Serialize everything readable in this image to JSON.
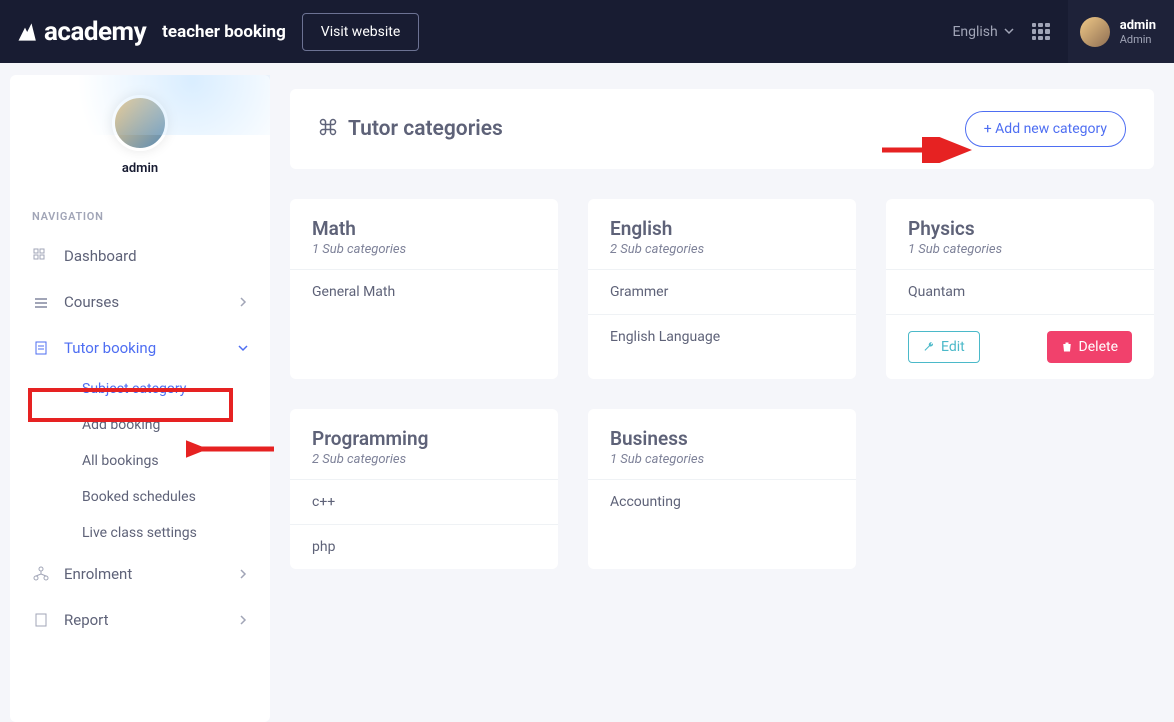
{
  "topnav": {
    "logo_text": "academy",
    "product_name": "teacher booking",
    "visit_label": "Visit website",
    "language": "English",
    "user_name": "admin",
    "user_role": "Admin"
  },
  "sidebar": {
    "profile_name": "admin",
    "section_label": "NAVIGATION",
    "items": {
      "dashboard": "Dashboard",
      "courses": "Courses",
      "tutor_booking": "Tutor booking",
      "enrolment": "Enrolment",
      "report": "Report"
    },
    "tutor_booking_children": {
      "subject_category": "Subject category",
      "add_booking": "Add booking",
      "all_bookings": "All bookings",
      "booked_schedules": "Booked schedules",
      "live_class_settings": "Live class settings"
    }
  },
  "page": {
    "title": "Tutor categories",
    "add_btn": "+ Add new category"
  },
  "action_labels": {
    "edit": "Edit",
    "delete": "Delete"
  },
  "categories": [
    {
      "title": "Math",
      "sub_label": "1 Sub categories",
      "subs": [
        "General Math"
      ],
      "show_actions": false
    },
    {
      "title": "English",
      "sub_label": "2 Sub categories",
      "subs": [
        "Grammer",
        "English Language"
      ],
      "show_actions": false
    },
    {
      "title": "Physics",
      "sub_label": "1 Sub categories",
      "subs": [
        "Quantam"
      ],
      "show_actions": true
    },
    {
      "title": "Programming",
      "sub_label": "2 Sub categories",
      "subs": [
        "c++",
        "php"
      ],
      "show_actions": false
    },
    {
      "title": "Business",
      "sub_label": "1 Sub categories",
      "subs": [
        "Accounting"
      ],
      "show_actions": false
    }
  ]
}
